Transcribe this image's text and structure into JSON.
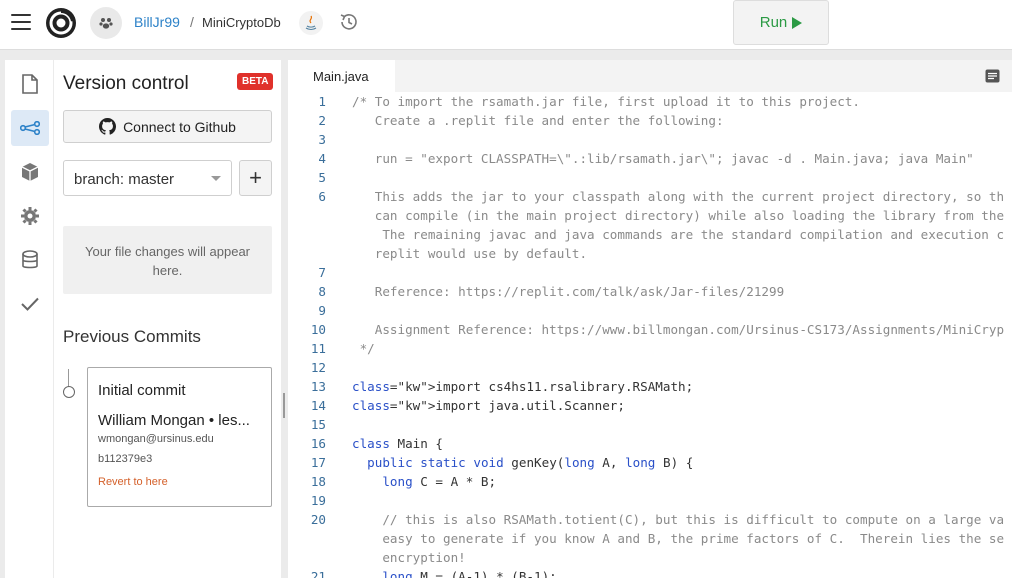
{
  "topbar": {
    "owner": "BillJr99",
    "separator": "/",
    "repl_name": "MiniCryptoDb",
    "run_label": "Run"
  },
  "vc": {
    "title": "Version control",
    "beta": "BETA",
    "github_button": "Connect to Github",
    "branch": "branch: master",
    "add_branch": "+",
    "changes_text": "Your file changes will appear here.",
    "previous_commits": "Previous Commits",
    "commit": {
      "message": "Initial commit",
      "author": "William Mongan • les...",
      "email": "wmongan@ursinus.edu",
      "hash": "b112379e3",
      "revert": "Revert to here"
    }
  },
  "editor": {
    "tab": "Main.java",
    "lines": [
      {
        "n": "1",
        "t": "/* To import the rsamath.jar file, first upload it to this project.",
        "c": "cm"
      },
      {
        "n": "2",
        "t": "   Create a .replit file and enter the following:",
        "c": "cm"
      },
      {
        "n": "3",
        "t": "",
        "c": "cm"
      },
      {
        "n": "4",
        "t": "   run = \"export CLASSPATH=\\\".:lib/rsamath.jar\\\"; javac -d . Main.java; java Main\"",
        "c": "cm"
      },
      {
        "n": "5",
        "t": "",
        "c": "cm"
      },
      {
        "n": "6",
        "t": "   This adds the jar to your classpath along with the current project directory, so th",
        "c": "cm"
      },
      {
        "n": "",
        "t": "   can compile (in the main project directory) while also loading the library from the",
        "c": "cm"
      },
      {
        "n": "",
        "t": "    The remaining javac and java commands are the standard compilation and execution c",
        "c": "cm"
      },
      {
        "n": "",
        "t": "   replit would use by default.",
        "c": "cm"
      },
      {
        "n": "7",
        "t": "",
        "c": "cm"
      },
      {
        "n": "8",
        "t": "   Reference: https://replit.com/talk/ask/Jar-files/21299",
        "c": "cm"
      },
      {
        "n": "9",
        "t": "",
        "c": "cm"
      },
      {
        "n": "10",
        "t": "   Assignment Reference: https://www.billmongan.com/Ursinus-CS173/Assignments/MiniCryp",
        "c": "cm"
      },
      {
        "n": "11",
        "t": " */",
        "c": "cm"
      },
      {
        "n": "12",
        "t": "",
        "c": ""
      },
      {
        "n": "13",
        "t": "import cs4hs11.rsalibrary.RSAMath;",
        "c": "imp"
      },
      {
        "n": "14",
        "t": "import java.util.Scanner;",
        "c": "imp"
      },
      {
        "n": "15",
        "t": "",
        "c": ""
      },
      {
        "n": "16",
        "t": "class Main {",
        "c": "cls"
      },
      {
        "n": "17",
        "t": "  public static void genKey(long A, long B) {",
        "c": "fn"
      },
      {
        "n": "18",
        "t": "    long C = A * B;",
        "c": "lng"
      },
      {
        "n": "19",
        "t": "",
        "c": ""
      },
      {
        "n": "20",
        "t": "    // this is also RSAMath.totient(C), but this is difficult to compute on a large va",
        "c": "cm"
      },
      {
        "n": "",
        "t": "    easy to generate if you know A and B, the prime factors of C.  Therein lies the se",
        "c": "cm"
      },
      {
        "n": "",
        "t": "    encryption!",
        "c": "cm"
      },
      {
        "n": "21",
        "t": "    long M = (A-1) * (B-1);",
        "c": "lng"
      }
    ]
  }
}
